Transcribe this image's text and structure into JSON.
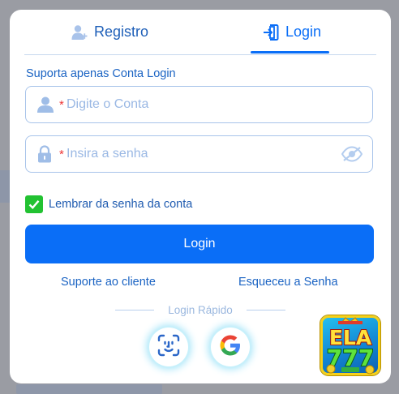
{
  "tabs": {
    "register_label": "Registro",
    "login_label": "Login",
    "active": "login"
  },
  "form": {
    "support_note": "Suporta apenas Conta Login",
    "account": {
      "required_mark": "*",
      "placeholder": "Digite o Conta",
      "value": ""
    },
    "password": {
      "required_mark": "*",
      "placeholder": "Insira a senha",
      "value": ""
    },
    "remember": {
      "label": "Lembrar da senha da conta",
      "checked": true
    },
    "submit_label": "Login"
  },
  "links": {
    "support": "Suporte ao cliente",
    "forgot": "Esqueceu a Senha"
  },
  "quick_login": {
    "label": "Login Rápido",
    "buttons": [
      {
        "icon": "face-id-icon"
      },
      {
        "icon": "google-icon"
      }
    ]
  },
  "logo": {
    "text_top": "ELA",
    "text_bottom": "777"
  },
  "colors": {
    "accent": "#0a6ef7",
    "link": "#1a63c3",
    "checkbox": "#22c232",
    "required": "#ee3333",
    "placeholder": "#9ab8e4"
  }
}
